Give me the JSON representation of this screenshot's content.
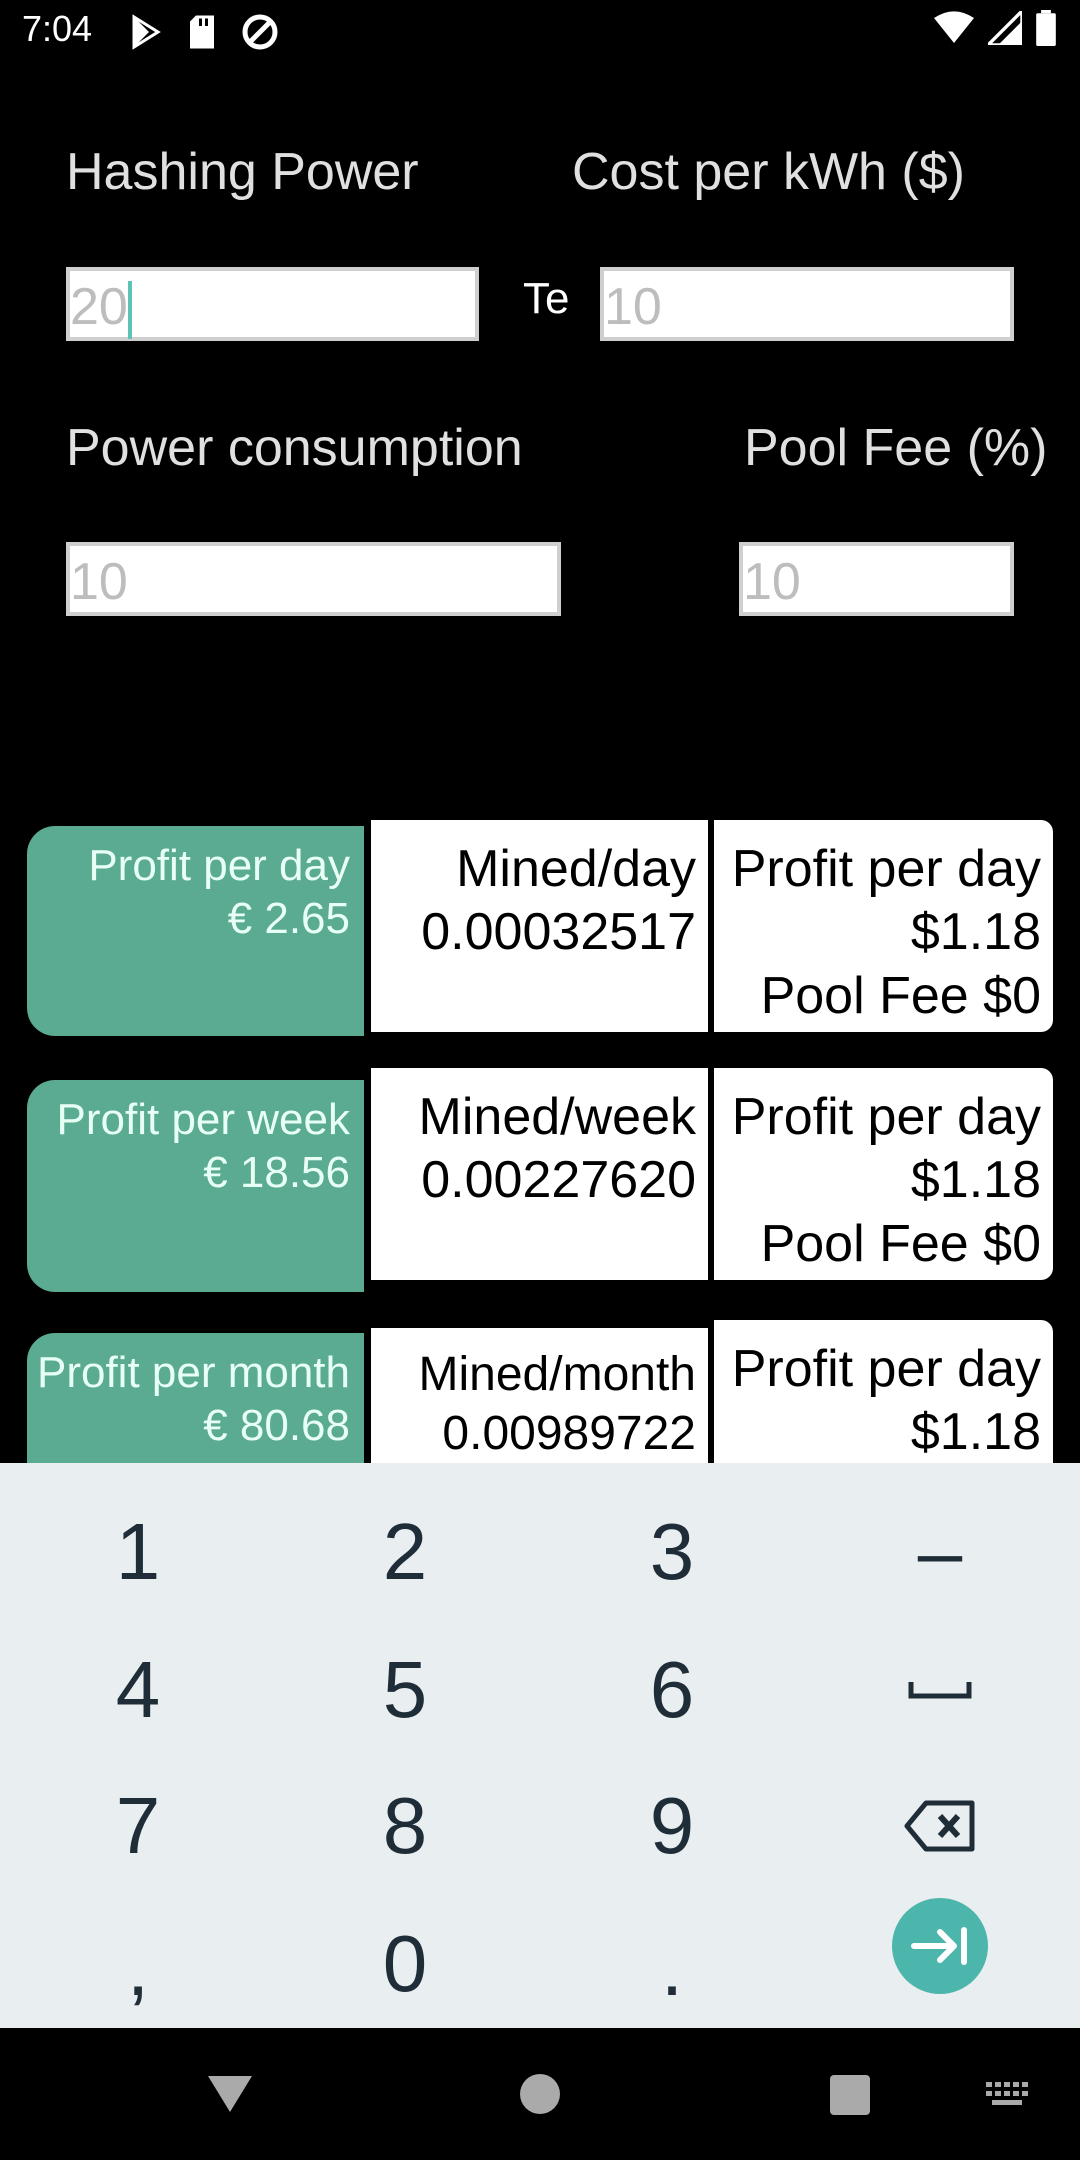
{
  "status_bar": {
    "time": "7:04",
    "left_icons": [
      "play-store-icon",
      "sd-card-icon",
      "at-sign-icon"
    ],
    "right_icons": [
      "wifi-icon",
      "signal-icon",
      "battery-icon"
    ]
  },
  "form": {
    "hashing_power": {
      "label": "Hashing Power",
      "value": "20",
      "unit": "Te"
    },
    "cost_per_kwh": {
      "label": "Cost per kWh ($)",
      "placeholder": "10"
    },
    "power_consumption": {
      "label": "Power consumption",
      "placeholder": "10"
    },
    "pool_fee": {
      "label": "Pool Fee (%)",
      "placeholder": "10"
    }
  },
  "results": [
    {
      "label": "Profit per day",
      "euro": "€ 2.65",
      "mined_label": "Mined/day",
      "mined_value": "0.00032517",
      "profit_label": "Profit per day",
      "profit_value": "$1.18",
      "pool_fee": "Pool Fee $0"
    },
    {
      "label": "Profit per week",
      "euro": "€ 18.56",
      "mined_label": "Mined/week",
      "mined_value": "0.00227620",
      "profit_label": "Profit per day",
      "profit_value": "$1.18",
      "pool_fee": "Pool Fee $0"
    },
    {
      "label": "Profit per month",
      "euro": "€ 80.68",
      "mined_label": "Mined/month",
      "mined_value": "0.00989722",
      "profit_label": "Profit per day",
      "profit_value": "$1.18"
    }
  ],
  "keyboard": {
    "rows": [
      [
        "1",
        "2",
        "3",
        "–"
      ],
      [
        "4",
        "5",
        "6",
        "␣"
      ],
      [
        "7",
        "8",
        "9",
        "backspace"
      ],
      [
        ",",
        "0",
        ".",
        "next"
      ]
    ],
    "accent": "#4db6ac"
  },
  "navbar": {
    "icons": [
      "back-triangle-icon",
      "home-circle-icon",
      "recents-square-icon",
      "keyboard-switch-icon"
    ]
  }
}
